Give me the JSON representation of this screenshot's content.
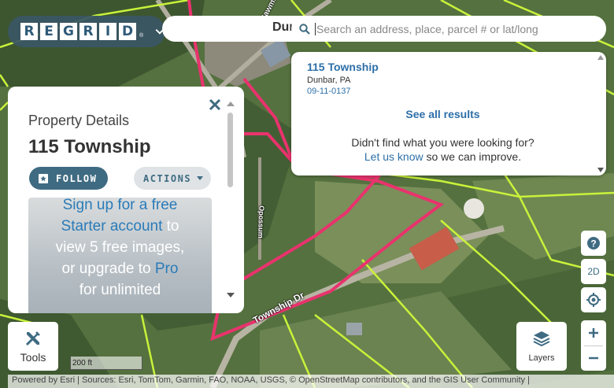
{
  "app": {
    "logo_letters": [
      "R",
      "E",
      "G",
      "R",
      "I",
      "D"
    ],
    "logo_mark": "®"
  },
  "search": {
    "behind_text": "Dun",
    "placeholder": "Search an address, place, parcel # or lat/long",
    "value": ""
  },
  "results": {
    "items": [
      {
        "title": "115 Township",
        "subtitle": "Dunbar, PA",
        "parcel_id": "09-11-0137"
      }
    ],
    "see_all": "See all results",
    "not_found": "Didn't find what you were looking for?",
    "contact_link": "Let us know",
    "contact_suffix": " so we can improve."
  },
  "panel": {
    "heading": "Property Details",
    "title": "115 Township",
    "follow_label": "FOLLOW",
    "actions_label": "ACTIONS",
    "upsell": {
      "line1a": "Sign up for a free",
      "line2a": "Starter account",
      "line2b": " to",
      "line3": "view 5 free images,",
      "line4a": "or upgrade to ",
      "line4b": "Pro",
      "line5": "for unlimited"
    }
  },
  "controls": {
    "help_icon": "question-circle-icon",
    "view_mode": "2D",
    "locate_icon": "crosshair-icon",
    "zoom_in": "+",
    "zoom_out": "−",
    "tools_label": "Tools",
    "layers_label": "Layers"
  },
  "map": {
    "road_labels": [
      "Township Dr",
      "Opossum",
      "Sawmill"
    ],
    "scale": "200 ft",
    "attribution": "Powered by Esri | Sources: Esri, TomTom, Garmin, FAO, NOAA, USGS, © OpenStreetMap contributors, and the GIS User Community |"
  },
  "colors": {
    "accent": "#3f6b82",
    "link": "#2d6fa8",
    "selected_parcel": "#e8336d",
    "parcel_lines": "#c9f23a"
  }
}
